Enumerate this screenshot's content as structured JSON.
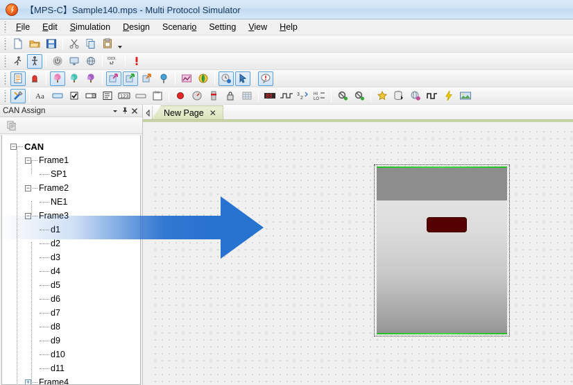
{
  "window": {
    "title": "【MPS-C】Sample140.mps - Multi Protocol Simulator",
    "app_icon": "mps-app-icon"
  },
  "menu": {
    "items": [
      {
        "label": "File",
        "mnemonic": "F"
      },
      {
        "label": "Edit",
        "mnemonic": "E"
      },
      {
        "label": "Simulation",
        "mnemonic": "S"
      },
      {
        "label": "Design",
        "mnemonic": "D"
      },
      {
        "label": "Scenario",
        "mnemonic": "o"
      },
      {
        "label": "Setting",
        "mnemonic": "g"
      },
      {
        "label": "View",
        "mnemonic": "V"
      },
      {
        "label": "Help",
        "mnemonic": "H"
      }
    ]
  },
  "toolbars": [
    {
      "name": "standard",
      "buttons": [
        {
          "icon": "new-document-icon",
          "active": false
        },
        {
          "icon": "open-folder-icon",
          "active": false
        },
        {
          "icon": "save-disk-icon",
          "active": false
        },
        {
          "sep": true
        },
        {
          "icon": "cut-scissors-icon",
          "active": false
        },
        {
          "icon": "copy-icon",
          "active": false
        },
        {
          "icon": "paste-clipboard-icon",
          "active": false
        },
        {
          "overflow": true
        }
      ]
    },
    {
      "name": "simulation",
      "buttons": [
        {
          "icon": "run-walk-icon",
          "active": false
        },
        {
          "icon": "stand-figure-icon",
          "active": true
        },
        {
          "sep": true
        },
        {
          "icon": "power-icon",
          "active": false
        },
        {
          "icon": "monitor-icon",
          "active": false
        },
        {
          "icon": "globe-network-icon",
          "active": false
        },
        {
          "sep": true
        },
        {
          "icon": "signal-trace-icon",
          "active": false
        },
        {
          "sep": true
        },
        {
          "icon": "alert-exclamation-icon",
          "active": false
        }
      ]
    },
    {
      "name": "design",
      "buttons": [
        {
          "icon": "page-list-icon",
          "active": true
        },
        {
          "icon": "alarm-light-icon",
          "active": false
        },
        {
          "sep": true
        },
        {
          "icon": "tree-pink-icon",
          "active": true
        },
        {
          "icon": "tree-teal-icon",
          "active": false
        },
        {
          "icon": "tree-purple-icon",
          "active": false
        },
        {
          "sep": true
        },
        {
          "icon": "link-in-pink-icon",
          "active": true
        },
        {
          "icon": "link-out-green-icon",
          "active": true
        },
        {
          "icon": "link-back-orange-icon",
          "active": false
        },
        {
          "icon": "balloon-pin-icon",
          "active": false
        },
        {
          "sep": true
        },
        {
          "icon": "chart-pink-icon",
          "active": false
        },
        {
          "icon": "globe-yellow-icon",
          "active": false
        },
        {
          "sep": true
        },
        {
          "icon": "clock-sync-icon",
          "active": true
        },
        {
          "icon": "pointer-blue-icon",
          "active": true
        },
        {
          "sep": true
        },
        {
          "icon": "comment-alert-icon",
          "active": true
        }
      ]
    },
    {
      "name": "widgets",
      "buttons": [
        {
          "icon": "tools-wrench-icon",
          "active": true
        },
        {
          "sep": true
        },
        {
          "icon": "text-label-icon",
          "active": false
        },
        {
          "icon": "textbox-icon",
          "active": false
        },
        {
          "icon": "checkbox-icon",
          "active": false
        },
        {
          "icon": "combobox-icon",
          "active": false
        },
        {
          "icon": "listbox-icon",
          "active": false
        },
        {
          "icon": "numeric-field-icon",
          "active": false
        },
        {
          "icon": "button-icon",
          "active": false
        },
        {
          "icon": "group-box-icon",
          "active": false
        },
        {
          "sep": true
        },
        {
          "icon": "led-round-red-icon",
          "active": false
        },
        {
          "icon": "gauge-meter-icon",
          "active": false
        },
        {
          "icon": "slider-vertical-icon",
          "active": false
        },
        {
          "icon": "lock-icon",
          "active": false
        },
        {
          "icon": "grid-matrix-icon",
          "active": false
        },
        {
          "sep": true
        },
        {
          "icon": "seven-segment-icon",
          "active": false
        },
        {
          "icon": "pulse-edge-icon",
          "active": false
        },
        {
          "icon": "counter-321-icon",
          "active": false
        },
        {
          "icon": "hi-lo-icon",
          "active": false
        },
        {
          "sep": true
        },
        {
          "icon": "can-node-out-icon",
          "active": false
        },
        {
          "icon": "can-node-in-icon",
          "active": false
        },
        {
          "sep": true
        },
        {
          "icon": "star-favorite-icon",
          "active": false
        },
        {
          "icon": "database-insert-icon",
          "active": false
        },
        {
          "icon": "globe-record-icon",
          "active": false
        },
        {
          "icon": "square-wave-icon",
          "active": false
        },
        {
          "icon": "lightning-bolt-icon",
          "active": false
        },
        {
          "icon": "image-picture-icon",
          "active": false
        }
      ]
    }
  ],
  "panel": {
    "title": "CAN Assign",
    "dropdown_icon": "chevron-down-icon",
    "pin_icon": "pin-icon",
    "close_icon": "close-icon",
    "toolbar_icon": "copy-page-icon",
    "tree": [
      {
        "label": "CAN",
        "level": 0,
        "expander": "-",
        "root": true
      },
      {
        "label": "Frame1",
        "level": 1,
        "expander": "-"
      },
      {
        "label": "SP1",
        "level": 2,
        "expander": ""
      },
      {
        "label": "Frame2",
        "level": 1,
        "expander": "-"
      },
      {
        "label": "NE1",
        "level": 2,
        "expander": ""
      },
      {
        "label": "Frame3",
        "level": 1,
        "expander": "-"
      },
      {
        "label": "d1",
        "level": 2,
        "expander": ""
      },
      {
        "label": "d2",
        "level": 2,
        "expander": ""
      },
      {
        "label": "d3",
        "level": 2,
        "expander": ""
      },
      {
        "label": "d4",
        "level": 2,
        "expander": ""
      },
      {
        "label": "d5",
        "level": 2,
        "expander": ""
      },
      {
        "label": "d6",
        "level": 2,
        "expander": ""
      },
      {
        "label": "d7",
        "level": 2,
        "expander": ""
      },
      {
        "label": "d8",
        "level": 2,
        "expander": ""
      },
      {
        "label": "d9",
        "level": 2,
        "expander": ""
      },
      {
        "label": "d10",
        "level": 2,
        "expander": ""
      },
      {
        "label": "d11",
        "level": 2,
        "expander": ""
      },
      {
        "label": "Frame4",
        "level": 1,
        "expander": "+"
      }
    ]
  },
  "document": {
    "tab_nav_icon": "tab-scroll-left-icon",
    "tabs": [
      {
        "label": "New Page",
        "close": "✕",
        "active": true
      }
    ],
    "canvas": {
      "object": {
        "name": "device-panel-shape",
        "selected": true,
        "header_color": "#8d8d8d",
        "body_color": "#cfcfcf",
        "accent_color": "#25c225",
        "led": {
          "name": "led-indicator",
          "color": "#560101"
        }
      }
    }
  },
  "annotation": {
    "arrow": {
      "name": "pointer-arrow-annotation",
      "color": "#2872d0",
      "direction": "right"
    }
  }
}
